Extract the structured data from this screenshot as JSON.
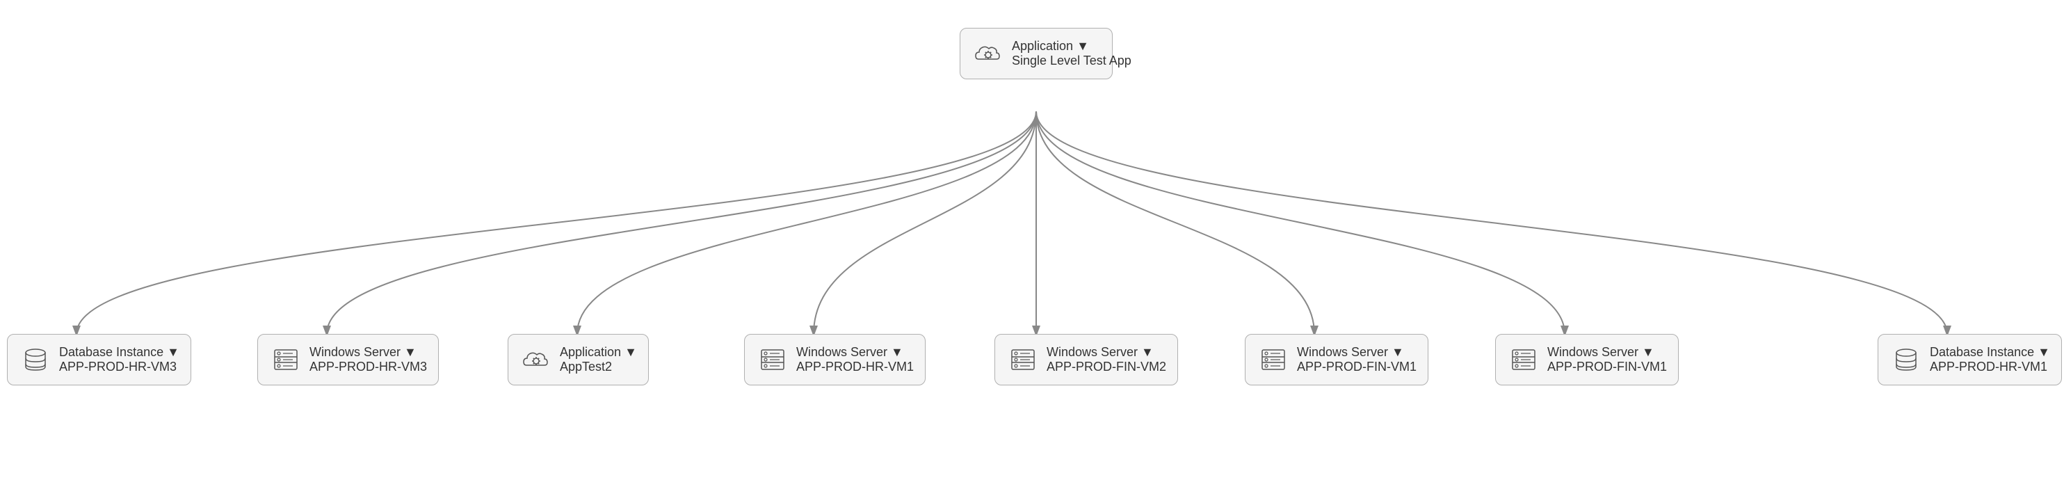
{
  "diagram": {
    "root": {
      "id": "root-node",
      "type": "Application",
      "name": "Single Level Test App",
      "icon": "cloud-gear"
    },
    "children": [
      {
        "id": "child-1",
        "type": "Database Instance",
        "name": "APP-PROD-HR-VM3",
        "icon": "database"
      },
      {
        "id": "child-2",
        "type": "Windows Server",
        "name": "APP-PROD-HR-VM3",
        "icon": "server"
      },
      {
        "id": "child-3",
        "type": "Application",
        "name": "AppTest2",
        "icon": "cloud-gear"
      },
      {
        "id": "child-4",
        "type": "Windows Server",
        "name": "APP-PROD-HR-VM1",
        "icon": "server"
      },
      {
        "id": "child-5",
        "type": "Windows Server",
        "name": "APP-PROD-FIN-VM2",
        "icon": "server"
      },
      {
        "id": "child-6",
        "type": "Windows Server",
        "name": "APP-PROD-FIN-VM1",
        "icon": "server"
      },
      {
        "id": "child-7",
        "type": "Windows Server",
        "name": "APP-PROD-FIN-VM1",
        "icon": "server"
      },
      {
        "id": "child-8",
        "type": "Database Instance",
        "name": "APP-PROD-HR-VM1",
        "icon": "database"
      }
    ]
  }
}
